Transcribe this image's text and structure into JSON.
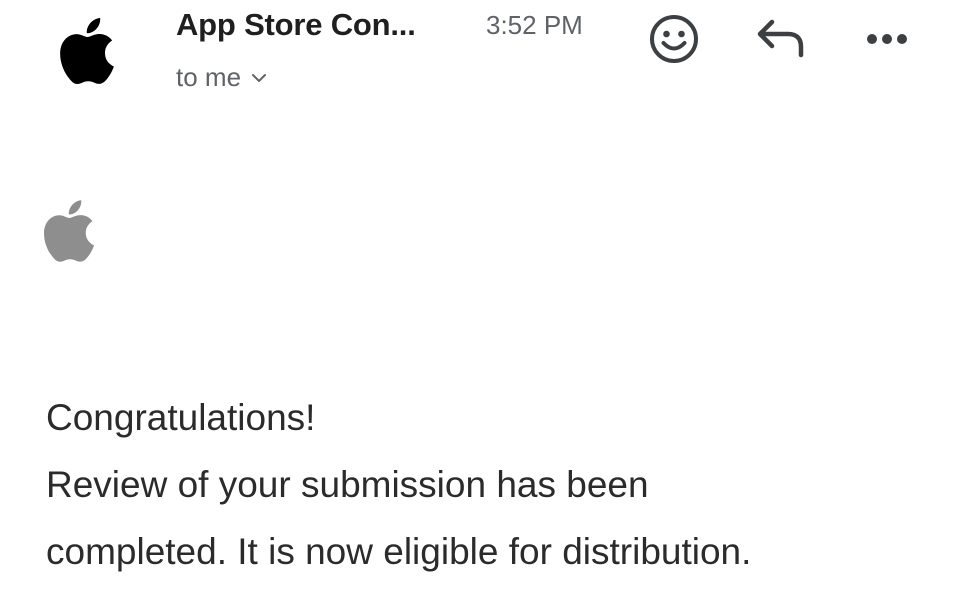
{
  "email": {
    "sender_name": "App Store Con...",
    "time": "3:52 PM",
    "recipient_label": "to me",
    "body": {
      "greeting": "Congratulations!",
      "line1": "Review of your submission has been",
      "line2": "completed. It is now eligible for distribution."
    }
  },
  "icons": {
    "avatar": "apple-logo-icon",
    "emoji": "smiley-face-icon",
    "reply": "reply-arrow-icon",
    "more": "more-horizontal-icon",
    "recipient_toggle": "chevron-down-icon",
    "body_logo": "apple-logo-icon"
  },
  "colors": {
    "avatar_logo": "#000000",
    "body_logo": "#8e8e8e",
    "secondary_text": "#5f6368",
    "icon": "#3c4043"
  }
}
